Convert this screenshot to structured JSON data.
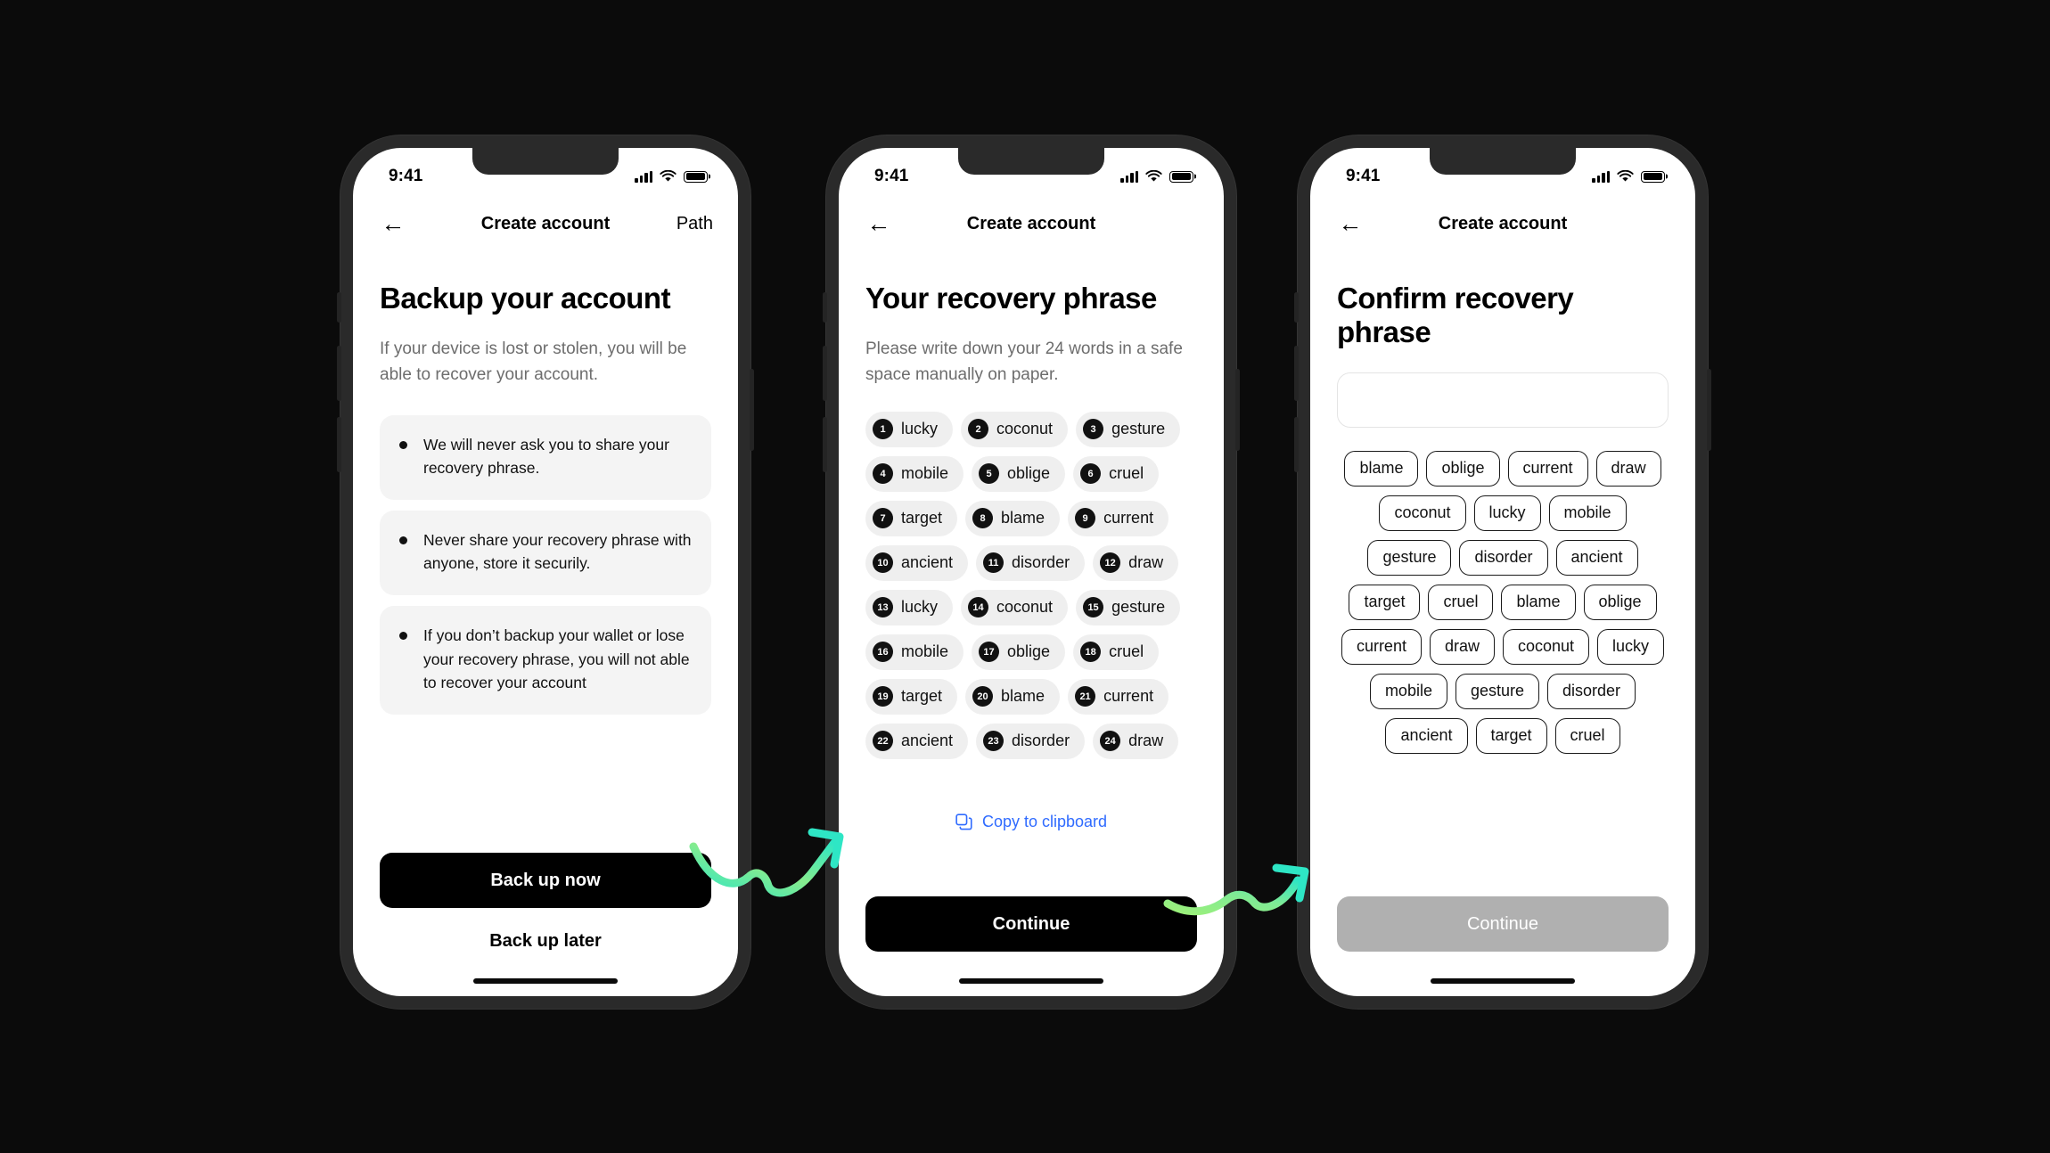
{
  "canvas": {
    "background": "#0b0b0b"
  },
  "accent": {
    "link": "#2f6bff",
    "arrow_start": "#2ee6c5",
    "arrow_end": "#9cf07a",
    "disabled": "#b0b0b0"
  },
  "status_bar": {
    "time": "9:41",
    "icons": [
      "signal-icon",
      "wifi-icon",
      "battery-icon"
    ]
  },
  "screens": [
    {
      "id": "backup-your-account",
      "nav": {
        "back_icon": "arrow-left-icon",
        "title": "Create account",
        "right_action": "Path"
      },
      "heading": "Backup your account",
      "subtitle": "If your device is lost or stolen, you will be able to recover your account.",
      "cards": [
        "We will never ask you to share your recovery phrase.",
        "Never share your recovery phrase with anyone, store it securily.",
        "If you don’t backup your wallet or lose your recovery phrase, you will not able to recover your account"
      ],
      "primary_button": "Back up now",
      "secondary_button": "Back up later"
    },
    {
      "id": "your-recovery-phrase",
      "nav": {
        "back_icon": "arrow-left-icon",
        "title": "Create account",
        "right_action": ""
      },
      "heading": "Your recovery phrase",
      "subtitle": "Please write down your 24 words in a safe space manually on paper.",
      "words": [
        {
          "num": "1",
          "word": "lucky"
        },
        {
          "num": "2",
          "word": "coconut"
        },
        {
          "num": "3",
          "word": "gesture"
        },
        {
          "num": "4",
          "word": "mobile"
        },
        {
          "num": "5",
          "word": "oblige"
        },
        {
          "num": "6",
          "word": "cruel"
        },
        {
          "num": "7",
          "word": "target"
        },
        {
          "num": "8",
          "word": "blame"
        },
        {
          "num": "9",
          "word": "current"
        },
        {
          "num": "10",
          "word": "ancient"
        },
        {
          "num": "11",
          "word": "disorder"
        },
        {
          "num": "12",
          "word": "draw"
        },
        {
          "num": "13",
          "word": "lucky"
        },
        {
          "num": "14",
          "word": "coconut"
        },
        {
          "num": "15",
          "word": "gesture"
        },
        {
          "num": "16",
          "word": "mobile"
        },
        {
          "num": "17",
          "word": "oblige"
        },
        {
          "num": "18",
          "word": "cruel"
        },
        {
          "num": "19",
          "word": "target"
        },
        {
          "num": "20",
          "word": "blame"
        },
        {
          "num": "21",
          "word": "current"
        },
        {
          "num": "22",
          "word": "ancient"
        },
        {
          "num": "23",
          "word": "disorder"
        },
        {
          "num": "24",
          "word": "draw"
        }
      ],
      "copy_link": {
        "icon": "copy-icon",
        "label": "Copy to clipboard"
      },
      "primary_button": "Continue"
    },
    {
      "id": "confirm-recovery-phrase",
      "nav": {
        "back_icon": "arrow-left-icon",
        "title": "Create account",
        "right_action": ""
      },
      "heading": "Confirm recovery phrase",
      "input": {
        "value": "",
        "placeholder": ""
      },
      "choices": [
        "blame",
        "oblige",
        "current",
        "draw",
        "coconut",
        "lucky",
        "mobile",
        "gesture",
        "disorder",
        "ancient",
        "target",
        "cruel",
        "blame",
        "oblige",
        "current",
        "draw",
        "coconut",
        "lucky",
        "mobile",
        "gesture",
        "disorder",
        "ancient",
        "target",
        "cruel"
      ],
      "primary_button": "Continue",
      "primary_button_disabled": true
    }
  ],
  "connectors": [
    {
      "id": "arrow-screen1-to-screen2",
      "from": "backup-your-account",
      "to": "your-recovery-phrase"
    },
    {
      "id": "arrow-screen2-to-screen3",
      "from": "your-recovery-phrase",
      "to": "confirm-recovery-phrase"
    }
  ]
}
